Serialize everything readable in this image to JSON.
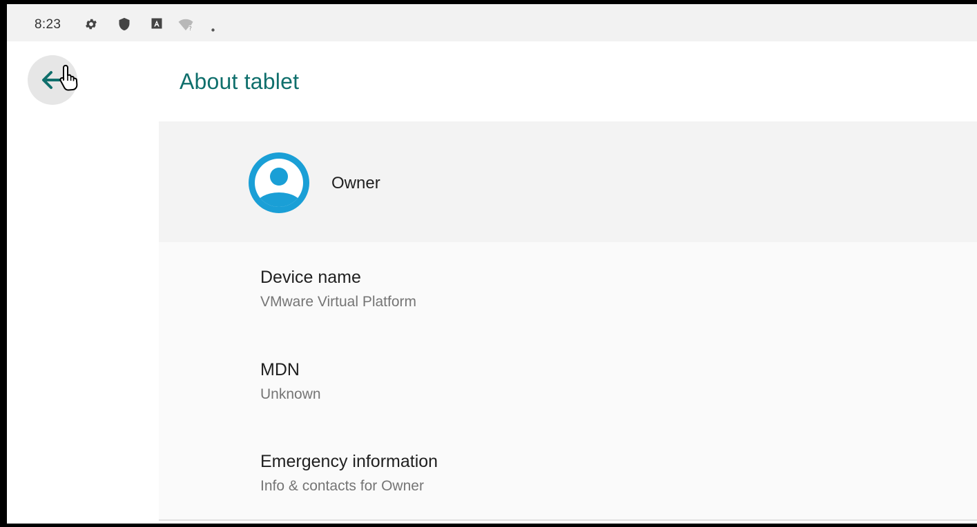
{
  "status_bar": {
    "time": "8:23",
    "icons": [
      "settings-gear-icon",
      "shield-icon",
      "keyboard-a-icon",
      "wifi-unknown-icon",
      "dot-icon"
    ]
  },
  "app_bar": {
    "back_icon": "arrow-left-icon",
    "title": "About tablet"
  },
  "owner": {
    "name": "Owner",
    "avatar_icon": "account-circle-icon",
    "accent_color": "#1a9fd6"
  },
  "items": [
    {
      "title": "Device name",
      "subtitle": "VMware Virtual Platform"
    },
    {
      "title": "MDN",
      "subtitle": "Unknown"
    },
    {
      "title": "Emergency information",
      "subtitle": "Info & contacts for Owner"
    }
  ],
  "colors": {
    "title_teal": "#0f6f6c",
    "status_bar_bg": "#f2f2f2",
    "owner_row_bg": "#f3f3f3"
  }
}
